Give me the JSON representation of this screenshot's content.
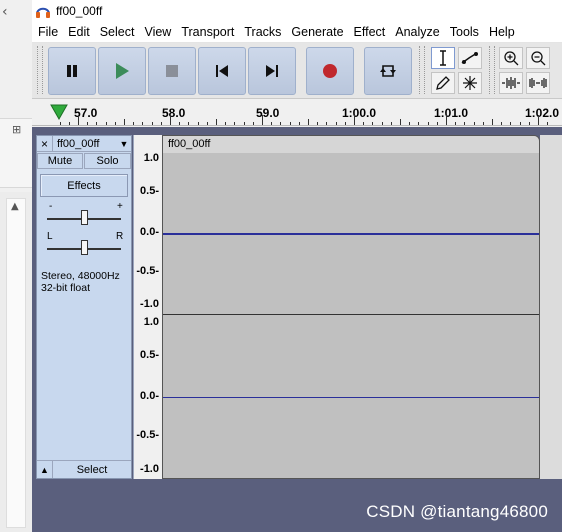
{
  "window": {
    "title": "ff00_00ff"
  },
  "menu": [
    "File",
    "Edit",
    "Select",
    "View",
    "Transport",
    "Tracks",
    "Generate",
    "Effect",
    "Analyze",
    "Tools",
    "Help"
  ],
  "transport": {
    "pause": "pause-icon",
    "play": "play-icon",
    "stop": "stop-icon",
    "skip_start": "skip-to-start-icon",
    "skip_end": "skip-to-end-icon",
    "record": "record-icon",
    "loop": "loop-icon"
  },
  "tools": [
    "selection-tool-icon",
    "envelope-tool-icon",
    "draw-tool-icon",
    "multi-tool-icon"
  ],
  "edit_tools": [
    "zoom-in-icon",
    "zoom-out-icon",
    "trim-icon",
    "silence-icon"
  ],
  "timeline": {
    "labels": [
      "57.0",
      "58.0",
      "59.0",
      "1:00.0",
      "1:01.0",
      "1:02.0"
    ]
  },
  "track": {
    "name": "ff00_00ff",
    "clip_name": "ff00_00ff",
    "mute_label": "Mute",
    "solo_label": "Solo",
    "effects_label": "Effects",
    "gain_minus": "-",
    "gain_plus": "+",
    "pan_left": "L",
    "pan_right": "R",
    "info_line1": "Stereo, 48000Hz",
    "info_line2": "32-bit float",
    "select_label": "Select",
    "close": "×",
    "gain_level": 0.5,
    "pan_level": 0.5
  },
  "amplitude_labels": {
    "top": [
      "1.0",
      "0.5-",
      "0.0-",
      "-0.5-",
      "-1.0"
    ],
    "bottom": [
      "1.0",
      "0.5-",
      "0.0-",
      "-0.5-",
      "-1.0"
    ]
  },
  "watermark": "CSDN @tiantang46800",
  "colors": {
    "waveform_line": "#2a2f9a",
    "record": "#c0282d",
    "play": "#3c8c5a",
    "track_panel": "#c8d8ee"
  }
}
